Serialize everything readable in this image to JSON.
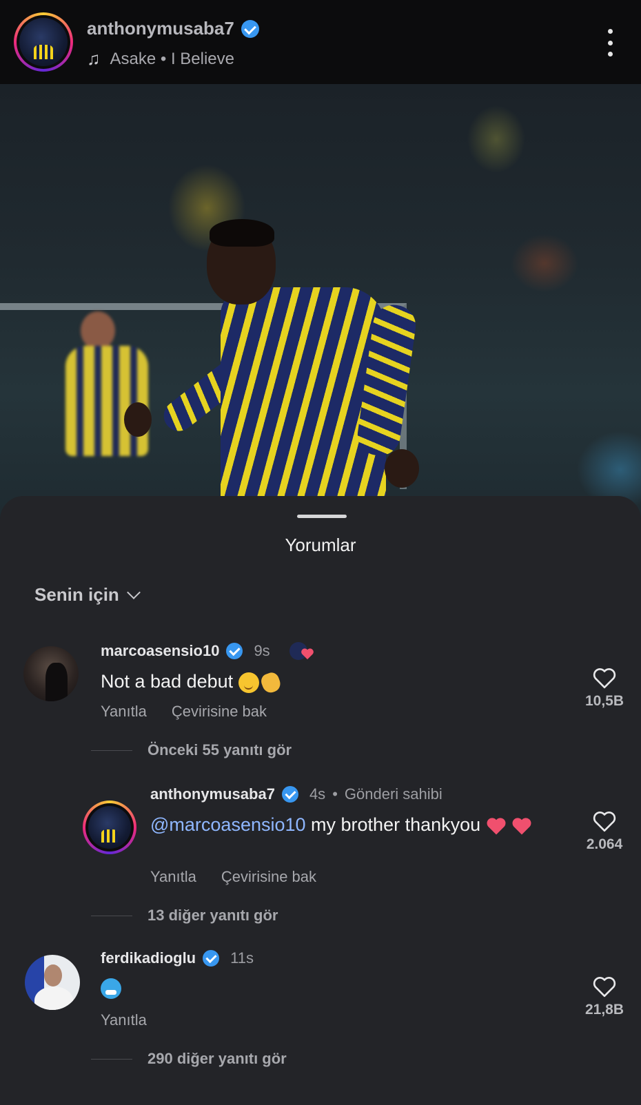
{
  "header": {
    "username": "anthonymusaba7",
    "music": "Asake • I Believe",
    "icons": {
      "verified": "verified-badge-icon",
      "music": "music-note-icon",
      "more": "more-vertical-icon"
    }
  },
  "sheet": {
    "title": "Yorumlar",
    "filter_label": "Senin için"
  },
  "comments": [
    {
      "username": "marcoasensio10",
      "time": "9s",
      "text": "Not a bad debut",
      "reply_label": "Yanıtla",
      "translate_label": "Çevirisine bak",
      "likes": "10,5B",
      "more_replies": "Önceki 55 yanıtı gör"
    },
    {
      "username": "anthonymusaba7",
      "time": "4s",
      "owner_label": "Gönderi sahibi",
      "mention": "@marcoasensio10",
      "text": " my brother thankyou",
      "reply_label": "Yanıtla",
      "translate_label": "Çevirisine bak",
      "likes": "2.064",
      "more_replies": "13 diğer yanıtı gör"
    },
    {
      "username": "ferdikadioglu",
      "time": "11s",
      "reply_label": "Yanıtla",
      "likes": "21,8B",
      "more_replies": "290 diğer yanıtı gör"
    }
  ],
  "colors": {
    "sheet_bg": "#232428",
    "header_bg": "#0c0c0d",
    "verified": "#3897f0",
    "mention": "#8fb7ff",
    "heart_emoji": "#f0506e"
  }
}
